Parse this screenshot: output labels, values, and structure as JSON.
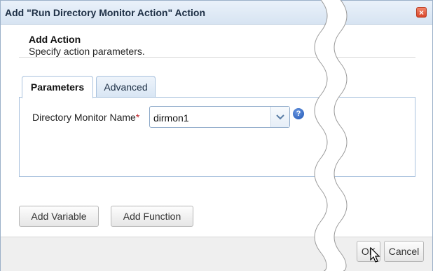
{
  "dialog": {
    "title": "Add \"Run Directory Monitor Action\" Action",
    "close_icon": "close-icon"
  },
  "header": {
    "title": "Add Action",
    "subtitle": "Specify action parameters."
  },
  "tabs": [
    {
      "label": "Parameters",
      "active": true
    },
    {
      "label": "Advanced",
      "active": false
    }
  ],
  "form": {
    "field_label": "Directory Monitor Name",
    "required_mark": "*",
    "field_value": "dirmon1",
    "help_icon": "help-icon",
    "help_text": "?"
  },
  "buttons": {
    "add_variable": "Add Variable",
    "add_function": "Add Function",
    "ok": "OK",
    "cancel": "Cancel"
  }
}
